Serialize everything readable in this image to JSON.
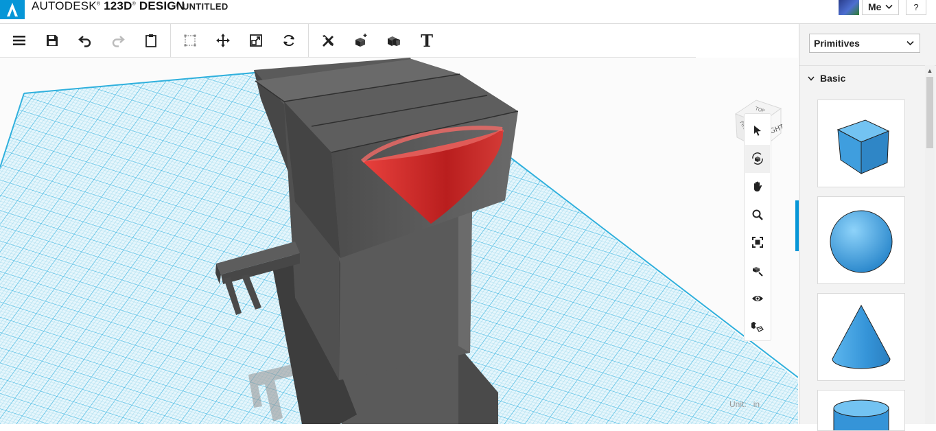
{
  "app": {
    "brand": "AUTODESK",
    "product": "123D",
    "product_suffix": "DESIGN",
    "document_separator": "\\",
    "document_name": "UNTITLED"
  },
  "user": {
    "name": "Me",
    "help_label": "?"
  },
  "toolbar": {
    "groups": [
      [
        "menu-icon",
        "save-icon",
        "undo-icon",
        "redo-icon",
        "clipboard-icon"
      ],
      [
        "bounding-box-icon",
        "move-icon",
        "scale-icon",
        "rotate-icon"
      ],
      [
        "construct-icon",
        "modify-icon",
        "combine-icon",
        "text-tool-icon"
      ]
    ],
    "text_tool_glyph": "T"
  },
  "navigation": {
    "tools": [
      "pointer-icon",
      "orbit-icon",
      "pan-icon",
      "zoom-icon",
      "fit-icon",
      "zoom-selected-icon",
      "visibility-icon",
      "snap-icon"
    ],
    "active": "orbit-icon"
  },
  "viewcube": {
    "top": "TOP",
    "front": "FRONT",
    "right": "RIGHT"
  },
  "status": {
    "unit_label": "Unit:",
    "unit_value": "in"
  },
  "panel": {
    "dropdown_value": "Primitives",
    "section": "Basic",
    "shapes": [
      "cube",
      "sphere",
      "cone",
      "cylinder"
    ]
  },
  "colors": {
    "accent": "#0696d7",
    "model_gray": "#5f5f5f",
    "cone_red": "#d8302e",
    "grid_line": "#8ed3ea",
    "grid_major": "#2fb0dd",
    "primitive_blue": "#4aa8e6"
  }
}
